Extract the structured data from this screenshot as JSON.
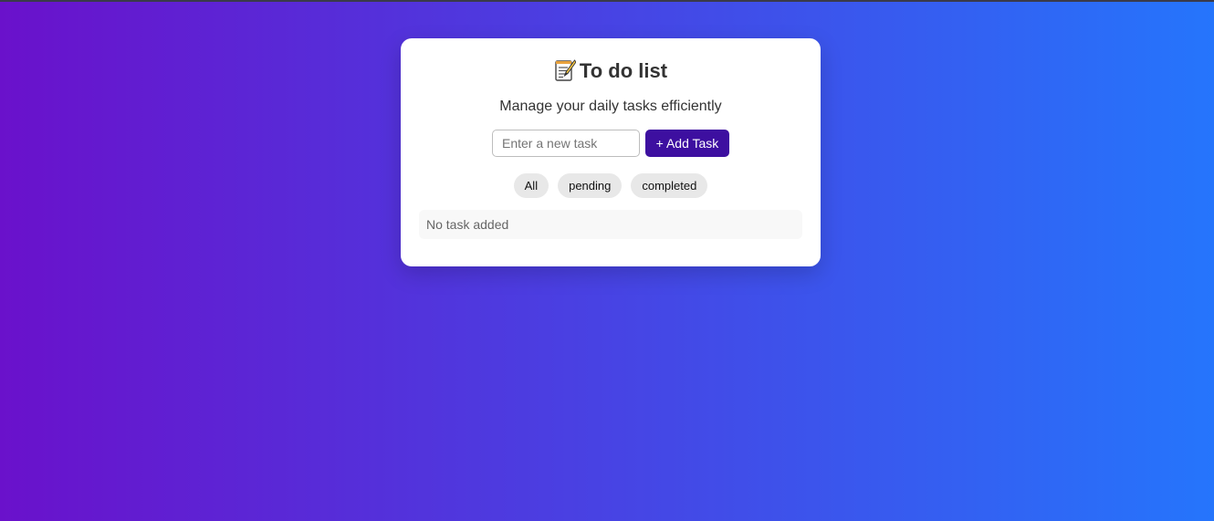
{
  "app": {
    "title": "To do list",
    "title_icon": "memo-icon",
    "subtitle": "Manage your daily tasks efficiently"
  },
  "add_task": {
    "input_value": "",
    "input_placeholder": "Enter a new task",
    "button_label": "+ Add Task"
  },
  "filters": [
    {
      "label": "All"
    },
    {
      "label": "pending"
    },
    {
      "label": "completed"
    }
  ],
  "task_list": {
    "empty_message": "No task added"
  },
  "colors": {
    "background_gradient_start": "#6a11cb",
    "background_gradient_end": "#2575fc",
    "card_background": "#ffffff",
    "add_button_background": "#3d0fa0",
    "filter_background": "#e8e8e8"
  }
}
